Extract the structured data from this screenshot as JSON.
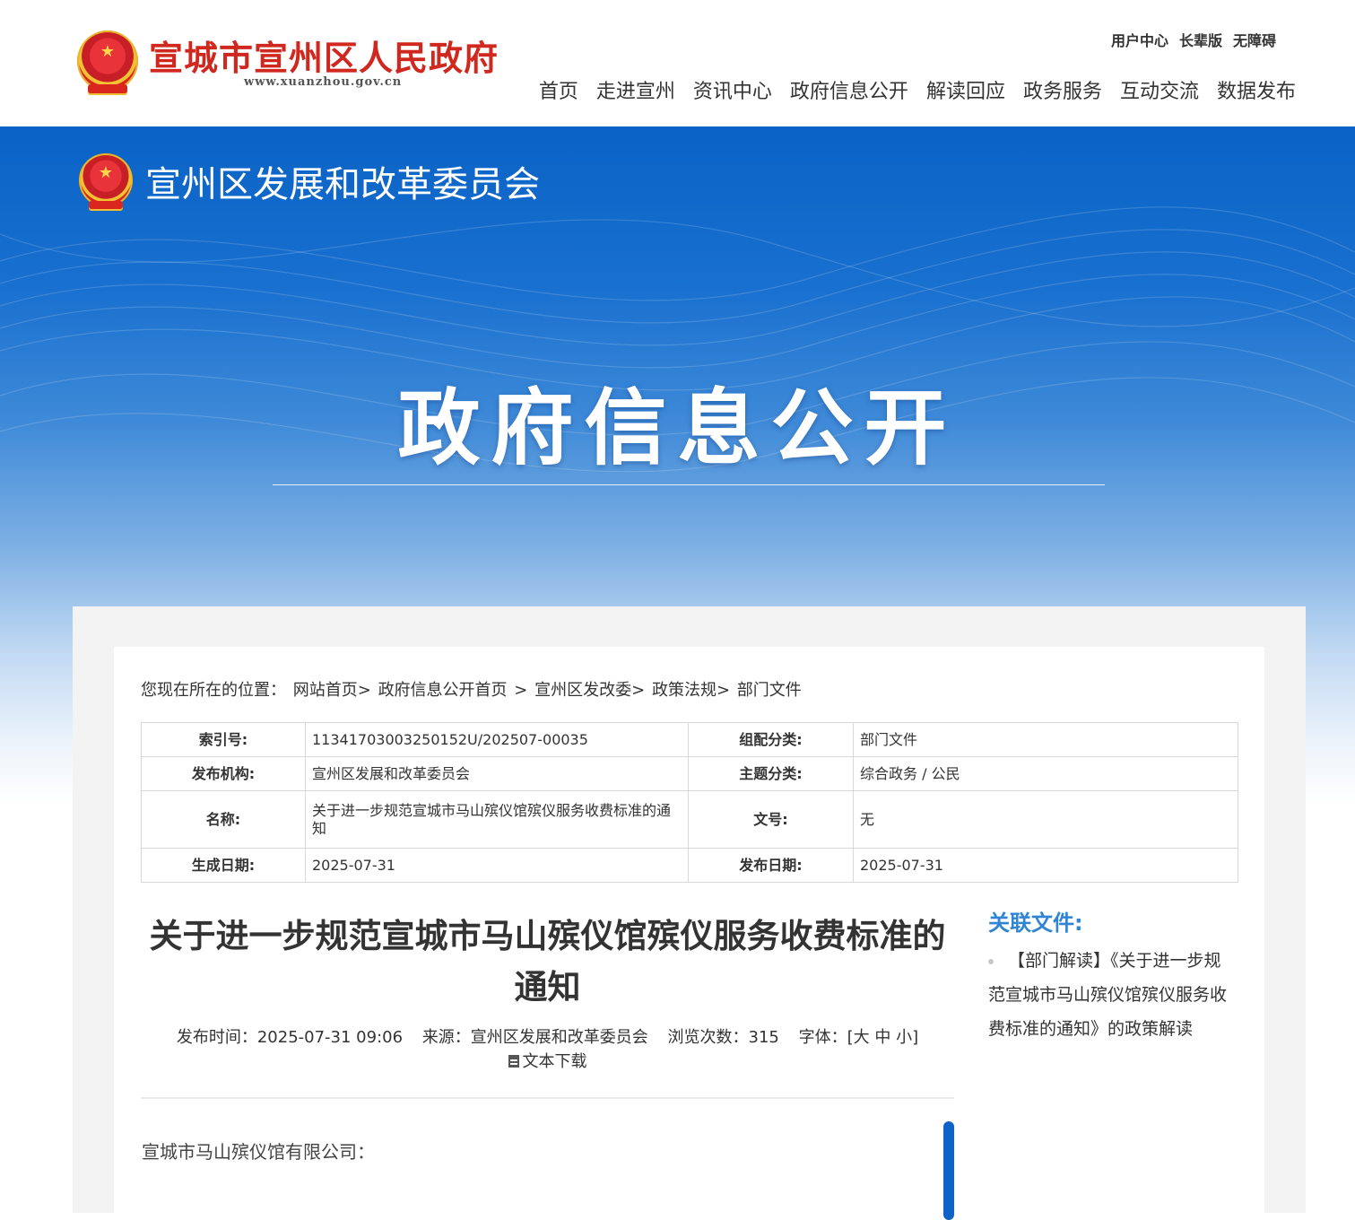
{
  "header": {
    "site_title": "宣城市宣州区人民政府",
    "site_url": "www.xuanzhou.gov.cn",
    "top_links": [
      "用户中心",
      "长辈版",
      "无障碍"
    ],
    "nav": [
      "首页",
      "走进宣州",
      "资讯中心",
      "政府信息公开",
      "解读回应",
      "政务服务",
      "互动交流",
      "数据发布"
    ]
  },
  "banner": {
    "dept_title": "宣州区发展和改革委员会",
    "section_title": "政府信息公开"
  },
  "breadcrumb": {
    "label": "您现在所在的位置：",
    "items": [
      "网站首页>",
      "政府信息公开首页",
      ">",
      "宣州区发改委>",
      "政策法规>",
      "部门文件"
    ]
  },
  "meta": {
    "index_label": "索引号:",
    "index_value": "11341703003250152U/202507-00035",
    "category_label": "组配分类:",
    "category_value": "部门文件",
    "publisher_label": "发布机构:",
    "publisher_value": "宣州区发展和改革委员会",
    "topic_label": "主题分类:",
    "topic_value": "综合政务 / 公民",
    "name_label": "名称:",
    "name_value": "关于进一步规范宣城市马山殡仪馆殡仪服务收费标准的通知",
    "docno_label": "文号:",
    "docno_value": "无",
    "created_label": "生成日期:",
    "created_value": "2025-07-31",
    "published_label": "发布日期:",
    "published_value": "2025-07-31"
  },
  "article": {
    "title": "关于进一步规范宣城市马山殡仪馆殡仪服务收费标准的通知",
    "time_label": "发布时间：",
    "time_value": "2025-07-31 09:06",
    "source_label": "来源：",
    "source_value": "宣州区发展和改革委员会",
    "views_label": "浏览次数：",
    "views_value": "315",
    "font_label": "字体：",
    "font_open": "[",
    "font_large": "大",
    "font_medium": "中",
    "font_small": "小",
    "font_close": "]",
    "download_label": "文本下载",
    "salutation": "宣城市马山殡仪馆有限公司："
  },
  "related": {
    "heading": "关联文件:",
    "items": [
      "【部门解读】《关于进一步规范宣城市马山殡仪馆殡仪服务收费标准的通知》的政策解读"
    ]
  },
  "colors": {
    "brand_red": "#d0281f",
    "banner_blue": "#0962c6",
    "related_blue": "#2f84d4",
    "scroll_blue": "#0f63c8"
  }
}
